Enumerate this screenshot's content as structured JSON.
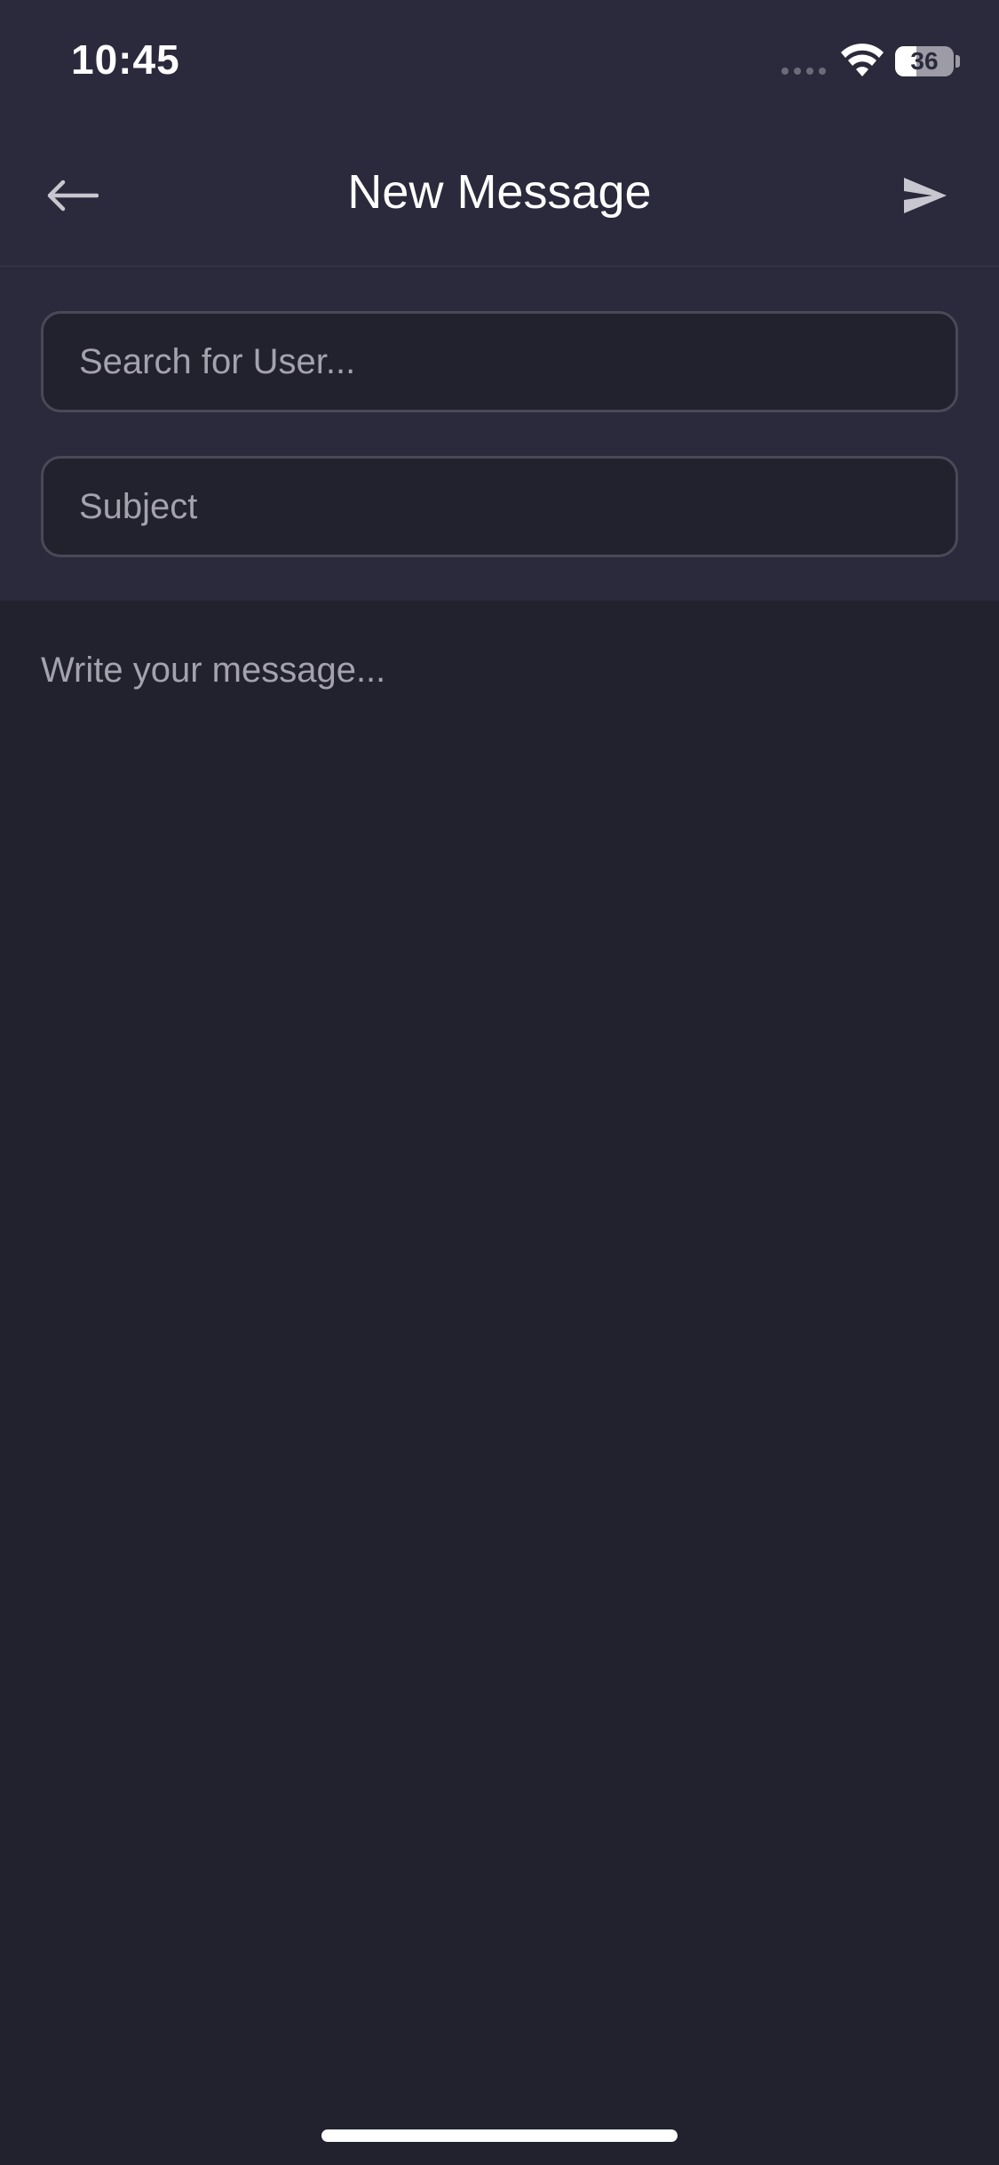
{
  "status_bar": {
    "time": "10:45",
    "battery_level": "36",
    "battery_fraction": 0.36
  },
  "nav": {
    "title": "New Message",
    "back_icon": "arrow-left-icon",
    "send_icon": "send-icon"
  },
  "form": {
    "recipient": {
      "value": "",
      "placeholder": "Search for User..."
    },
    "subject": {
      "value": "",
      "placeholder": "Subject"
    }
  },
  "message": {
    "value": "",
    "placeholder": "Write your message..."
  },
  "colors": {
    "header_background": "#2b2a3c",
    "body_background": "#22212e",
    "field_border": "#4a4957",
    "placeholder_text": "#a3a2ad",
    "icon_color": "#c8c7d0"
  }
}
